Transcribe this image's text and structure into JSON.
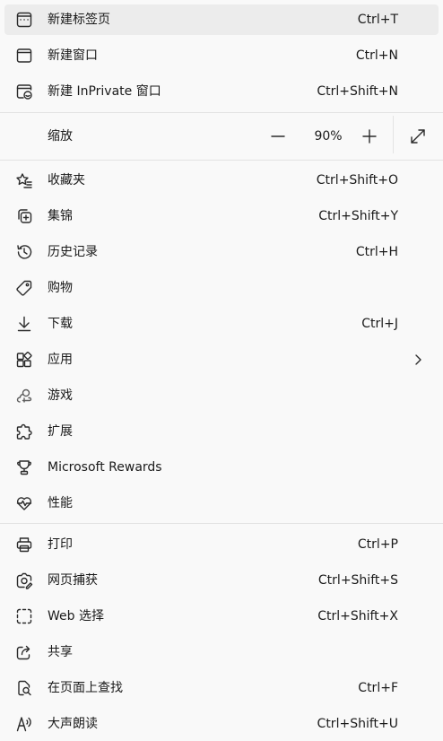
{
  "menu": {
    "new_tab": {
      "label": "新建标签页",
      "shortcut": "Ctrl+T"
    },
    "new_window": {
      "label": "新建窗口",
      "shortcut": "Ctrl+N"
    },
    "new_inprivate": {
      "label": "新建 InPrivate 窗口",
      "shortcut": "Ctrl+Shift+N"
    },
    "zoom": {
      "label": "缩放",
      "value": "90%"
    },
    "favorites": {
      "label": "收藏夹",
      "shortcut": "Ctrl+Shift+O"
    },
    "collections": {
      "label": "集锦",
      "shortcut": "Ctrl+Shift+Y"
    },
    "history": {
      "label": "历史记录",
      "shortcut": "Ctrl+H"
    },
    "shopping": {
      "label": "购物"
    },
    "downloads": {
      "label": "下载",
      "shortcut": "Ctrl+J"
    },
    "apps": {
      "label": "应用"
    },
    "games": {
      "label": "游戏"
    },
    "extensions": {
      "label": "扩展"
    },
    "rewards": {
      "label": "Microsoft Rewards"
    },
    "performance": {
      "label": "性能"
    },
    "print": {
      "label": "打印",
      "shortcut": "Ctrl+P"
    },
    "web_capture": {
      "label": "网页捕获",
      "shortcut": "Ctrl+Shift+S"
    },
    "web_select": {
      "label": "Web 选择",
      "shortcut": "Ctrl+Shift+X"
    },
    "share": {
      "label": "共享"
    },
    "find": {
      "label": "在页面上查找",
      "shortcut": "Ctrl+F"
    },
    "read_aloud": {
      "label": "大声朗读",
      "shortcut": "Ctrl+Shift+U"
    }
  },
  "colors": {
    "background": "#f9f9f9",
    "highlight": "#ececec",
    "separator": "#e3e3e3"
  }
}
